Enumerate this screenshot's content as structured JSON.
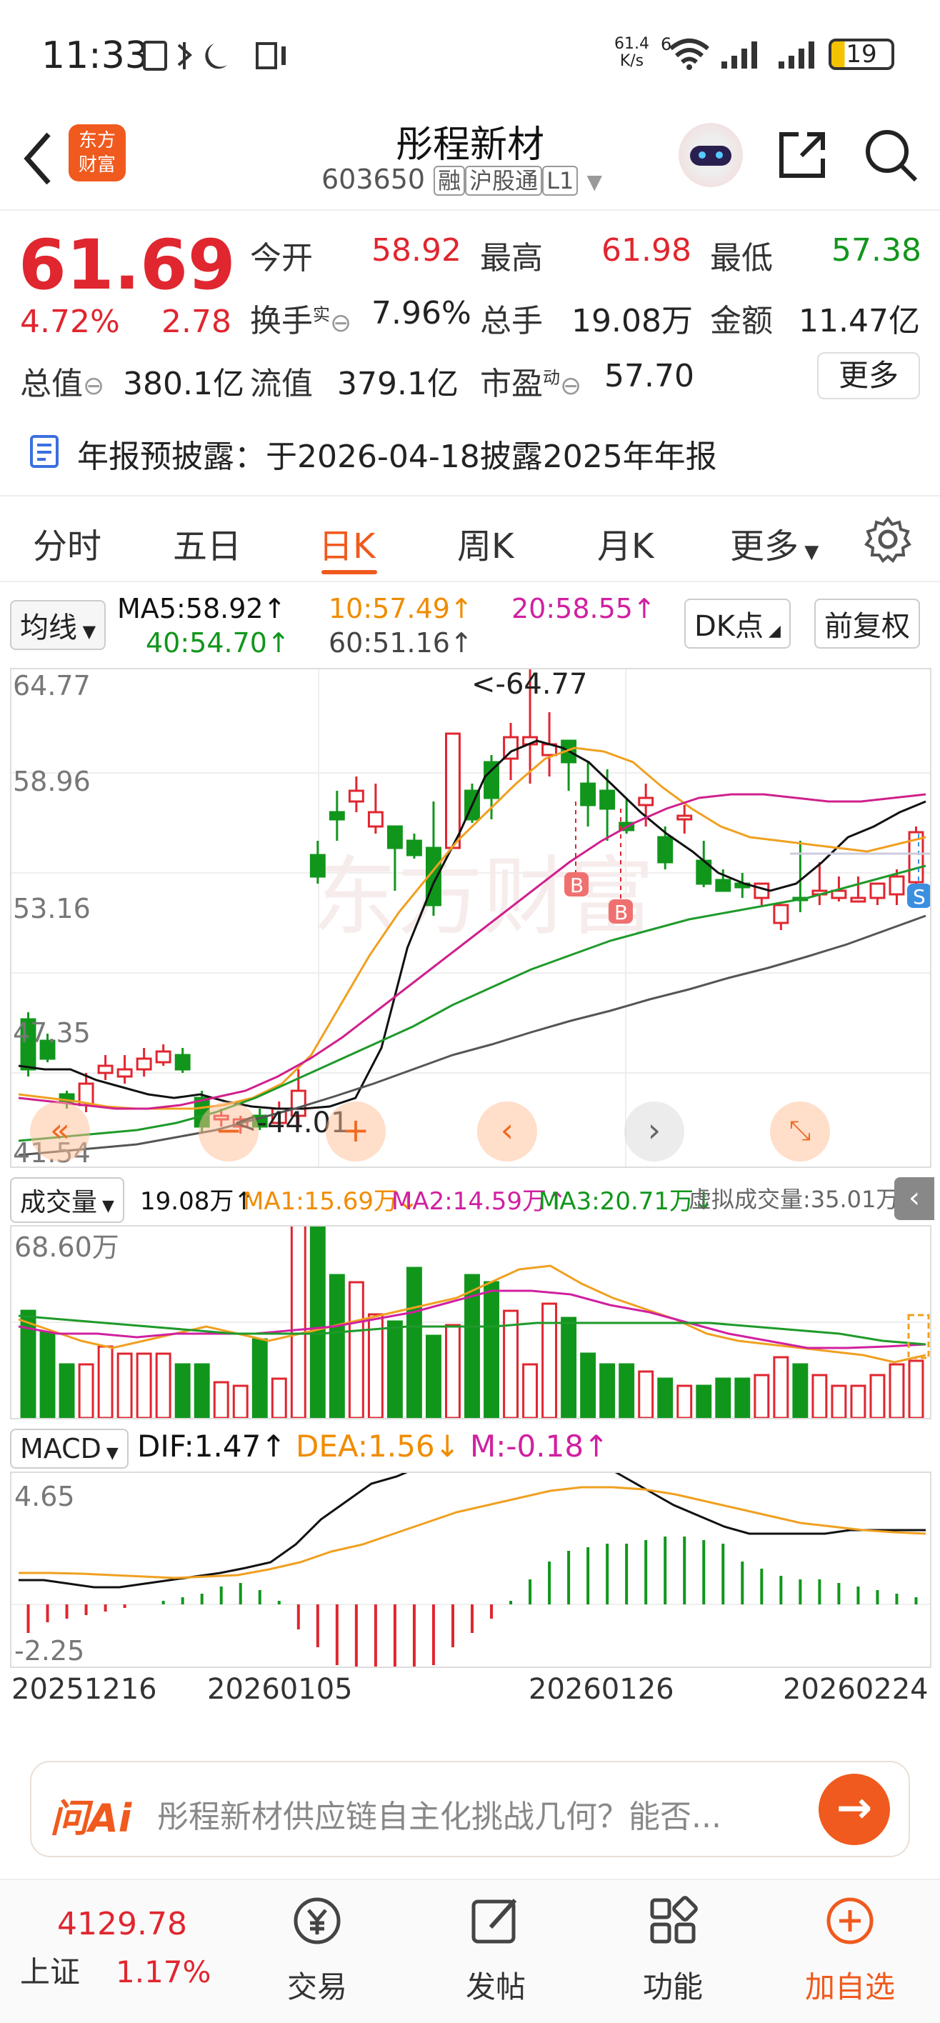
{
  "status": {
    "time": "11:33",
    "speed": "61.4\nK/s",
    "speed_top": "61.4",
    "speed_bottom": "K/s",
    "net": "6",
    "battery": "19"
  },
  "header": {
    "title": "彤程新材",
    "code": "603650",
    "tags": [
      "融",
      "沪股通",
      "L1"
    ],
    "logo_line1": "东方",
    "logo_line2": "财富"
  },
  "quote": {
    "price": "61.69",
    "change_pct": "4.72%",
    "change": "2.78",
    "open_label": "今开",
    "open": "58.92",
    "high_label": "最高",
    "high": "61.98",
    "low_label": "最低",
    "low": "57.38",
    "turnover_label": "换手",
    "turnover_sup": "实",
    "turnover": "7.96%",
    "volume_label": "总手",
    "volume": "19.08万",
    "amount_label": "金额",
    "amount": "11.47亿",
    "mktcap_label": "总值",
    "mktcap": "380.1亿",
    "float_label": "流值",
    "float": "379.1亿",
    "pe_label": "市盈",
    "pe_sup": "动",
    "pe": "57.70",
    "more_label": "更多"
  },
  "notice": {
    "text": "年报预披露：于2026-04-18披露2025年年报"
  },
  "tabs": [
    "分时",
    "五日",
    "日K",
    "周K",
    "月K",
    "更多"
  ],
  "active_tab": "日K",
  "ma": {
    "selector": "均线",
    "ma5": "MA5:58.92↑",
    "ma10": "10:57.49↑",
    "ma20": "20:58.55↑",
    "ma40": "40:54.70↑",
    "ma60": "60:51.16↑",
    "dk": "DK点",
    "adjust": "前复权"
  },
  "kchart": {
    "y_labels": [
      "64.77",
      "58.96",
      "53.16",
      "47.35",
      "41.54"
    ],
    "max_label": "<-64.77",
    "min_label": "<-44.01",
    "markers": [
      "B",
      "B",
      "S"
    ],
    "watermark": "东方财富"
  },
  "volume": {
    "selector": "成交量",
    "val": "19.08万↑",
    "ma1": "MA1:15.69万↓",
    "ma2": "MA2:14.59万↑",
    "ma3": "MA3:20.71万↓",
    "virtual": "虚拟成交量:35.01万",
    "top_label": "68.60万"
  },
  "macd": {
    "selector": "MACD",
    "dif": "DIF:1.47↑",
    "dea": "DEA:1.56↓",
    "m": "M:-0.18↑",
    "top_label": "4.65",
    "bottom_label": "-2.25"
  },
  "dates": [
    "20251216",
    "20260105",
    "20260126",
    "20260224"
  ],
  "ask": {
    "brand": "问Ai",
    "text": "彤程新材供应链自主化挑战几何？能否..."
  },
  "nav": {
    "index_value": "4129.78",
    "index_name": "上证",
    "index_change": "1.17%",
    "items": [
      "交易",
      "发帖",
      "功能",
      "加自选"
    ]
  },
  "colors": {
    "up": "#e0262f",
    "down": "#11961c",
    "accent": "#f05a1e",
    "ma5": "#111111",
    "ma10": "#f0a020",
    "ma20": "#d0208c",
    "ma40": "#1e9a2a",
    "ma60": "#555555"
  }
}
